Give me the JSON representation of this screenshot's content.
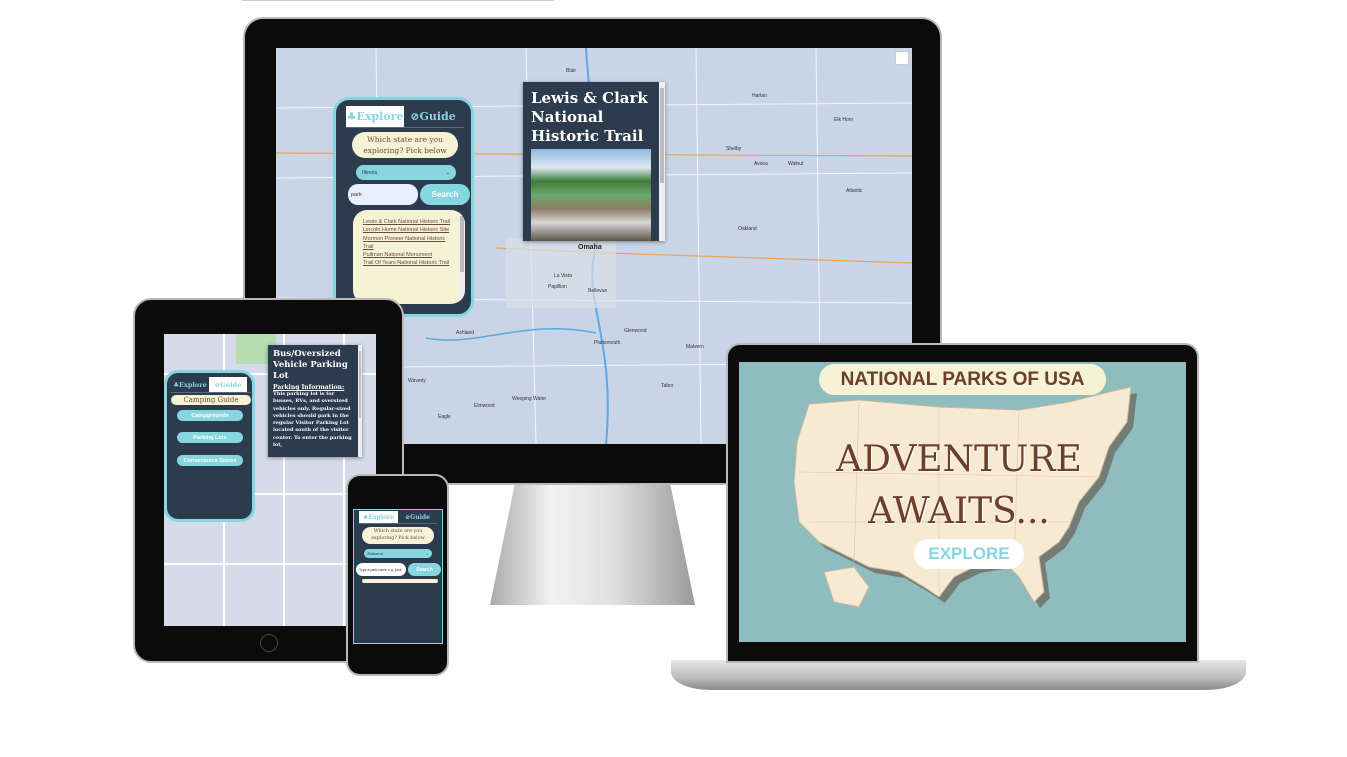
{
  "desktop": {
    "tabs": [
      {
        "label": "Explore",
        "icon": "tree-icon"
      },
      {
        "label": "Guide",
        "icon": "compass-icon"
      }
    ],
    "prompt": "Which state are you exploring? Pick below",
    "state_select": "Illinois",
    "search_value": "park",
    "search_button": "Search",
    "results": [
      "Lewis & Clark National Historic Trail",
      "Lincoln Home National Historic Site",
      "Mormon Pioneer National Historic Trail",
      "Pullman National Monument",
      "Trail Of Tears National Historic Trail"
    ],
    "popup_title": "Lewis & Clark National Historic Trail",
    "map_labels": [
      "Omaha",
      "La Vista",
      "Papillion",
      "Bellevue",
      "Council Bluffs",
      "Glenwood",
      "Blair",
      "Shelby",
      "Atlantic",
      "Malvern",
      "Tabor",
      "Avoca",
      "Walnut",
      "Elk Horn",
      "Harlan",
      "Oakland",
      "Red Oak",
      "Ashland",
      "Waverly",
      "Eagle",
      "Elmwood",
      "Weeping Water",
      "Nehawka",
      "Plattsmouth"
    ]
  },
  "tablet": {
    "tabs": [
      {
        "label": "Explore",
        "icon": "tree-icon"
      },
      {
        "label": "Guide",
        "icon": "compass-icon"
      }
    ],
    "guide_title": "Camping Guide",
    "guide_items": [
      "Campgrounds",
      "Parking Lots",
      "Convenience Stores"
    ],
    "popup_title": "Bus/Oversized Vehicle Parking Lot",
    "popup_subtitle": "Parking Information:",
    "popup_body": "This parking lot is for busses, RVs, and oversized vehicles only. Regular-sized vehicles should park in the regular Visitor Parking Lot located south of the visitor center. To enter the parking lot,"
  },
  "phone": {
    "tabs": [
      {
        "label": "Explore",
        "icon": "tree-icon"
      },
      {
        "label": "Guide",
        "icon": "compass-icon"
      }
    ],
    "prompt": "Which state are you exploring? Pick below",
    "state_select": "Alabama",
    "search_placeholder": "Type a park name e.g. park",
    "search_button": "Search"
  },
  "laptop": {
    "title": "NATIONAL PARKS OF USA",
    "headline_1": "ADVENTURE",
    "headline_2": "AWAITS...",
    "explore_button": "EXPLORE"
  },
  "colors": {
    "panel": "#2c3b4e",
    "accent": "#86d6e0",
    "cream": "#f6f2d6",
    "brown": "#6b3e2e",
    "landing_bg": "#8fbdbf"
  }
}
